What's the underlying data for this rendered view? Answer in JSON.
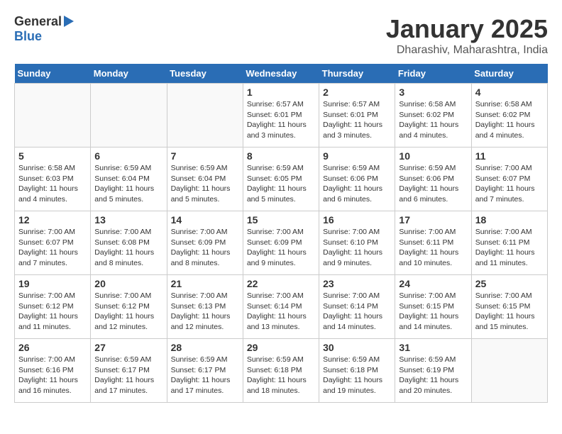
{
  "header": {
    "logo_general": "General",
    "logo_blue": "Blue",
    "title": "January 2025",
    "subtitle": "Dharashiv, Maharashtra, India"
  },
  "days_of_week": [
    "Sunday",
    "Monday",
    "Tuesday",
    "Wednesday",
    "Thursday",
    "Friday",
    "Saturday"
  ],
  "weeks": [
    [
      {
        "day": "",
        "info": ""
      },
      {
        "day": "",
        "info": ""
      },
      {
        "day": "",
        "info": ""
      },
      {
        "day": "1",
        "info": "Sunrise: 6:57 AM\nSunset: 6:01 PM\nDaylight: 11 hours\nand 3 minutes."
      },
      {
        "day": "2",
        "info": "Sunrise: 6:57 AM\nSunset: 6:01 PM\nDaylight: 11 hours\nand 3 minutes."
      },
      {
        "day": "3",
        "info": "Sunrise: 6:58 AM\nSunset: 6:02 PM\nDaylight: 11 hours\nand 4 minutes."
      },
      {
        "day": "4",
        "info": "Sunrise: 6:58 AM\nSunset: 6:02 PM\nDaylight: 11 hours\nand 4 minutes."
      }
    ],
    [
      {
        "day": "5",
        "info": "Sunrise: 6:58 AM\nSunset: 6:03 PM\nDaylight: 11 hours\nand 4 minutes."
      },
      {
        "day": "6",
        "info": "Sunrise: 6:59 AM\nSunset: 6:04 PM\nDaylight: 11 hours\nand 5 minutes."
      },
      {
        "day": "7",
        "info": "Sunrise: 6:59 AM\nSunset: 6:04 PM\nDaylight: 11 hours\nand 5 minutes."
      },
      {
        "day": "8",
        "info": "Sunrise: 6:59 AM\nSunset: 6:05 PM\nDaylight: 11 hours\nand 5 minutes."
      },
      {
        "day": "9",
        "info": "Sunrise: 6:59 AM\nSunset: 6:06 PM\nDaylight: 11 hours\nand 6 minutes."
      },
      {
        "day": "10",
        "info": "Sunrise: 6:59 AM\nSunset: 6:06 PM\nDaylight: 11 hours\nand 6 minutes."
      },
      {
        "day": "11",
        "info": "Sunrise: 7:00 AM\nSunset: 6:07 PM\nDaylight: 11 hours\nand 7 minutes."
      }
    ],
    [
      {
        "day": "12",
        "info": "Sunrise: 7:00 AM\nSunset: 6:07 PM\nDaylight: 11 hours\nand 7 minutes."
      },
      {
        "day": "13",
        "info": "Sunrise: 7:00 AM\nSunset: 6:08 PM\nDaylight: 11 hours\nand 8 minutes."
      },
      {
        "day": "14",
        "info": "Sunrise: 7:00 AM\nSunset: 6:09 PM\nDaylight: 11 hours\nand 8 minutes."
      },
      {
        "day": "15",
        "info": "Sunrise: 7:00 AM\nSunset: 6:09 PM\nDaylight: 11 hours\nand 9 minutes."
      },
      {
        "day": "16",
        "info": "Sunrise: 7:00 AM\nSunset: 6:10 PM\nDaylight: 11 hours\nand 9 minutes."
      },
      {
        "day": "17",
        "info": "Sunrise: 7:00 AM\nSunset: 6:11 PM\nDaylight: 11 hours\nand 10 minutes."
      },
      {
        "day": "18",
        "info": "Sunrise: 7:00 AM\nSunset: 6:11 PM\nDaylight: 11 hours\nand 11 minutes."
      }
    ],
    [
      {
        "day": "19",
        "info": "Sunrise: 7:00 AM\nSunset: 6:12 PM\nDaylight: 11 hours\nand 11 minutes."
      },
      {
        "day": "20",
        "info": "Sunrise: 7:00 AM\nSunset: 6:12 PM\nDaylight: 11 hours\nand 12 minutes."
      },
      {
        "day": "21",
        "info": "Sunrise: 7:00 AM\nSunset: 6:13 PM\nDaylight: 11 hours\nand 12 minutes."
      },
      {
        "day": "22",
        "info": "Sunrise: 7:00 AM\nSunset: 6:14 PM\nDaylight: 11 hours\nand 13 minutes."
      },
      {
        "day": "23",
        "info": "Sunrise: 7:00 AM\nSunset: 6:14 PM\nDaylight: 11 hours\nand 14 minutes."
      },
      {
        "day": "24",
        "info": "Sunrise: 7:00 AM\nSunset: 6:15 PM\nDaylight: 11 hours\nand 14 minutes."
      },
      {
        "day": "25",
        "info": "Sunrise: 7:00 AM\nSunset: 6:15 PM\nDaylight: 11 hours\nand 15 minutes."
      }
    ],
    [
      {
        "day": "26",
        "info": "Sunrise: 7:00 AM\nSunset: 6:16 PM\nDaylight: 11 hours\nand 16 minutes."
      },
      {
        "day": "27",
        "info": "Sunrise: 6:59 AM\nSunset: 6:17 PM\nDaylight: 11 hours\nand 17 minutes."
      },
      {
        "day": "28",
        "info": "Sunrise: 6:59 AM\nSunset: 6:17 PM\nDaylight: 11 hours\nand 17 minutes."
      },
      {
        "day": "29",
        "info": "Sunrise: 6:59 AM\nSunset: 6:18 PM\nDaylight: 11 hours\nand 18 minutes."
      },
      {
        "day": "30",
        "info": "Sunrise: 6:59 AM\nSunset: 6:18 PM\nDaylight: 11 hours\nand 19 minutes."
      },
      {
        "day": "31",
        "info": "Sunrise: 6:59 AM\nSunset: 6:19 PM\nDaylight: 11 hours\nand 20 minutes."
      },
      {
        "day": "",
        "info": ""
      }
    ]
  ]
}
